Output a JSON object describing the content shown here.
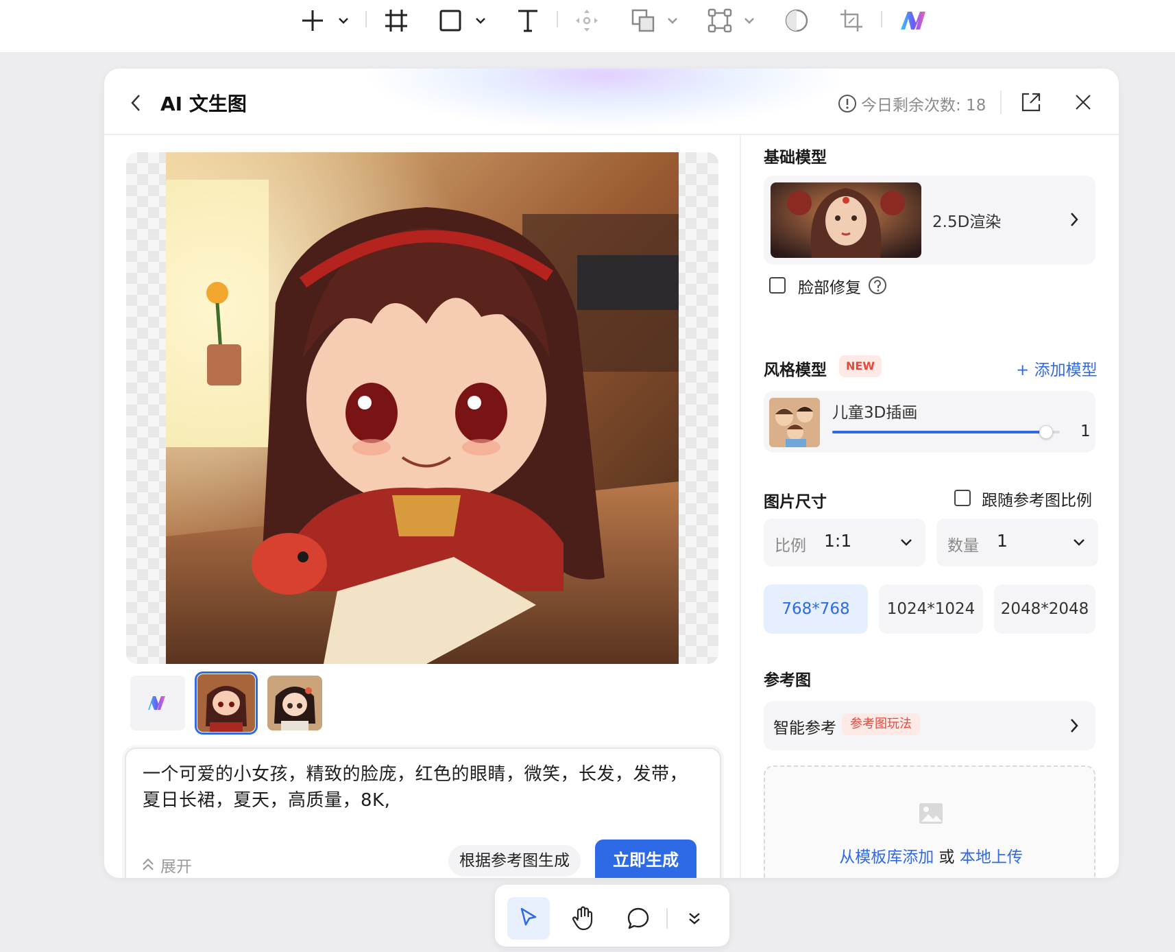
{
  "toolbar": {
    "tools": [
      {
        "name": "add",
        "icon": "plus-icon",
        "dropdown": true
      },
      {
        "name": "frame",
        "icon": "frame-icon",
        "dropdown": false
      },
      {
        "name": "shape",
        "icon": "rectangle-icon",
        "dropdown": true
      },
      {
        "name": "text",
        "icon": "text-icon",
        "dropdown": false
      },
      {
        "name": "move",
        "icon": "move-icon",
        "dropdown": false
      },
      {
        "name": "boolean",
        "icon": "boolean-icon",
        "dropdown": true
      },
      {
        "name": "path",
        "icon": "vector-icon",
        "dropdown": true
      },
      {
        "name": "mask",
        "icon": "circle-icon",
        "dropdown": false
      },
      {
        "name": "crop",
        "icon": "crop-icon",
        "dropdown": false
      },
      {
        "name": "ai",
        "icon": "ai-logo-icon",
        "dropdown": false
      }
    ]
  },
  "dialog": {
    "title": "AI 文生图",
    "quota_label": "今日剩余次数: 18"
  },
  "prompt": {
    "text": "一个可爱的小女孩，精致的脸庞，红色的眼睛，微笑，长发，发带，夏日长裙，夏天，高质量，8K,",
    "expand_label": "展开",
    "ref_generate_label": "根据参考图生成",
    "generate_label": "立即生成"
  },
  "thumbnails": {
    "selected_index": 1
  },
  "panel": {
    "base_model": {
      "title": "基础模型",
      "name": "2.5D渲染",
      "face_fix_label": "脸部修复",
      "face_fix_checked": false
    },
    "style_model": {
      "title": "风格模型",
      "new_badge": "NEW",
      "add_label": "+ 添加模型",
      "name": "儿童3D插画",
      "weight": 1,
      "weight_fraction": 0.94
    },
    "image_size": {
      "title": "图片尺寸",
      "follow_ratio_label": "跟随参考图比例",
      "follow_ratio_checked": false,
      "ratio_label": "比例",
      "ratio_value": "1:1",
      "count_label": "数量",
      "count_value": "1",
      "sizes": [
        "768*768",
        "1024*1024",
        "2048*2048"
      ],
      "selected_size": "768*768"
    },
    "reference": {
      "title": "参考图",
      "smart_label": "智能参考",
      "smart_badge": "参考图玩法",
      "add_from_templates": "从模板库添加",
      "or": "或",
      "local_upload": "本地上传"
    }
  },
  "bottom_toolbar": {
    "tools": [
      "select-icon",
      "hand-icon",
      "comment-icon",
      "more-icon"
    ],
    "active": "select-icon"
  },
  "colors": {
    "accent": "#2f6ae6",
    "badge_red": "#e8483b"
  }
}
